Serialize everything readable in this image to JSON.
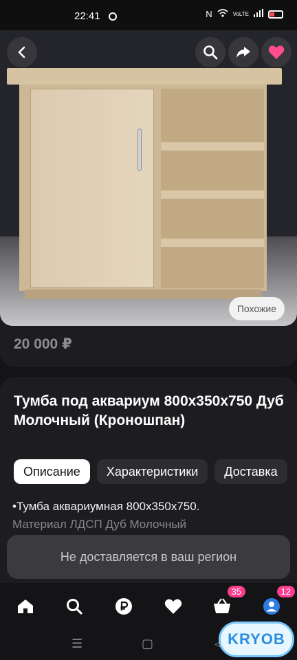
{
  "status_bar": {
    "time": "22:41",
    "icons": [
      "nfc-icon",
      "wifi-icon",
      "signal-icon",
      "battery-icon"
    ],
    "net_label": "VoLTE"
  },
  "toolbar": {
    "back_icon": "chevron-left-icon",
    "search_icon": "search-icon",
    "share_icon": "share-arrow-icon",
    "favorite_icon": "heart-icon",
    "favorite_color": "#ff4d8d"
  },
  "media": {
    "similar_label": "Похожие"
  },
  "listing": {
    "price": "20 000 ₽",
    "title": "Тумба под аквариум 800х350х750 Дуб Молочный (Кроношпан)",
    "tabs": [
      {
        "label": "Описание",
        "active": true
      },
      {
        "label": "Характеристики",
        "active": false
      },
      {
        "label": "Доставка",
        "active": false
      }
    ],
    "description_line1": "•Тумба аквариумная 800х350х750.",
    "description_line2": "Материал ЛДСП Дуб Молочный"
  },
  "delivery": {
    "notice": "Не доставляется в ваш регион"
  },
  "bottom_nav": {
    "items": [
      {
        "icon": "home-icon",
        "badge": ""
      },
      {
        "icon": "search-icon",
        "badge": ""
      },
      {
        "icon": "ruble-icon",
        "badge": ""
      },
      {
        "icon": "heart-icon",
        "badge": ""
      },
      {
        "icon": "cart-icon",
        "badge": "35"
      },
      {
        "icon": "profile-icon",
        "badge": "12"
      }
    ],
    "accent_color": "#ff3c8f"
  },
  "watermark": {
    "text": "KRYOB"
  }
}
